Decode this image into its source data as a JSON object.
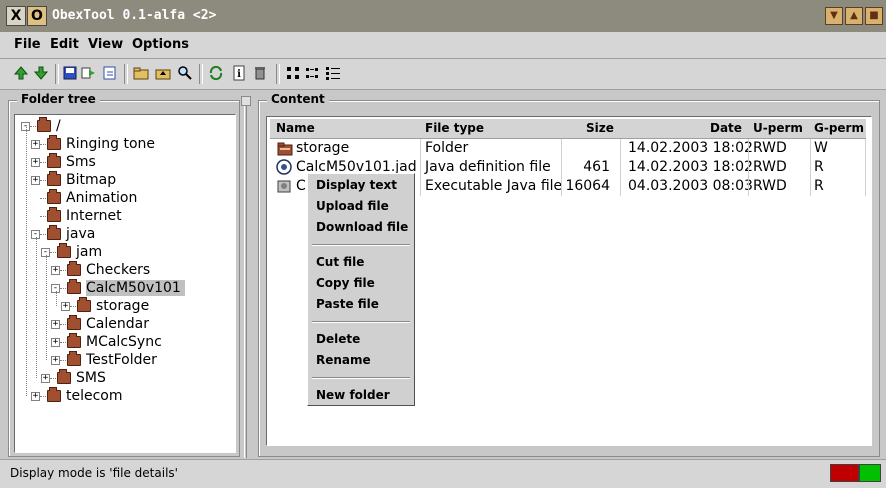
{
  "window": {
    "title": "ObexTool 0.1-alfa <2>",
    "close_glyph": "X",
    "app_glyph": "O"
  },
  "menu": [
    "File",
    "Edit",
    "View",
    "Options"
  ],
  "folder_tree": {
    "title": "Folder tree",
    "nodes": [
      {
        "label": "/",
        "level": 0,
        "expander": "-"
      },
      {
        "label": "Ringing tone",
        "level": 1,
        "expander": "+"
      },
      {
        "label": "Sms",
        "level": 1,
        "expander": "+"
      },
      {
        "label": "Bitmap",
        "level": 1,
        "expander": "+"
      },
      {
        "label": "Animation",
        "level": 1,
        "expander": ""
      },
      {
        "label": "Internet",
        "level": 1,
        "expander": ""
      },
      {
        "label": "java",
        "level": 1,
        "expander": "-"
      },
      {
        "label": "jam",
        "level": 2,
        "expander": "-"
      },
      {
        "label": "Checkers",
        "level": 3,
        "expander": "+"
      },
      {
        "label": "CalcM50v101",
        "level": 3,
        "expander": "-",
        "selected": true
      },
      {
        "label": "storage",
        "level": 4,
        "expander": "+"
      },
      {
        "label": "Calendar",
        "level": 3,
        "expander": "+"
      },
      {
        "label": "MCalcSync",
        "level": 3,
        "expander": "+"
      },
      {
        "label": "TestFolder",
        "level": 3,
        "expander": "+"
      },
      {
        "label": "SMS",
        "level": 2,
        "expander": "+"
      },
      {
        "label": "telecom",
        "level": 1,
        "expander": "+"
      }
    ]
  },
  "content": {
    "title": "Content",
    "columns": [
      "Name",
      "File type",
      "Size",
      "Date",
      "U-perm",
      "G-perm"
    ],
    "rows": [
      {
        "name": "storage",
        "type": "Folder",
        "size": "",
        "date": "14.02.2003 18:02",
        "uperm": "RWD",
        "gperm": "W",
        "icon": "folder-icon"
      },
      {
        "name": "CalcM50v101.jad",
        "type": "Java definition file",
        "size": "461",
        "date": "14.02.2003 18:02",
        "uperm": "RWD",
        "gperm": "R",
        "icon": "java-definition-icon"
      },
      {
        "name": "C",
        "type": "Executable Java file",
        "size": "16064",
        "date": "04.03.2003 08:03",
        "uperm": "RWD",
        "gperm": "R",
        "icon": "java-archive-icon"
      }
    ]
  },
  "context_menu": {
    "groups": [
      [
        "Display text",
        "Upload file",
        "Download file"
      ],
      [
        "Cut file",
        "Copy file",
        "Paste file"
      ],
      [
        "Delete",
        "Rename"
      ],
      [
        "New folder"
      ]
    ]
  },
  "status": {
    "text": "Display mode is 'file details'",
    "indicator_colors": [
      "#c00000",
      "#00c000"
    ]
  },
  "toolbar_icons": [
    "arrow-up-icon",
    "arrow-down-icon",
    "save-icon",
    "send-icon",
    "refresh-doc-icon",
    "open-folder-icon",
    "folder-up-icon",
    "search-icon",
    "sync-icon",
    "info-icon",
    "trash-icon",
    "large-icons-view-icon",
    "small-icons-view-icon",
    "list-view-icon"
  ]
}
